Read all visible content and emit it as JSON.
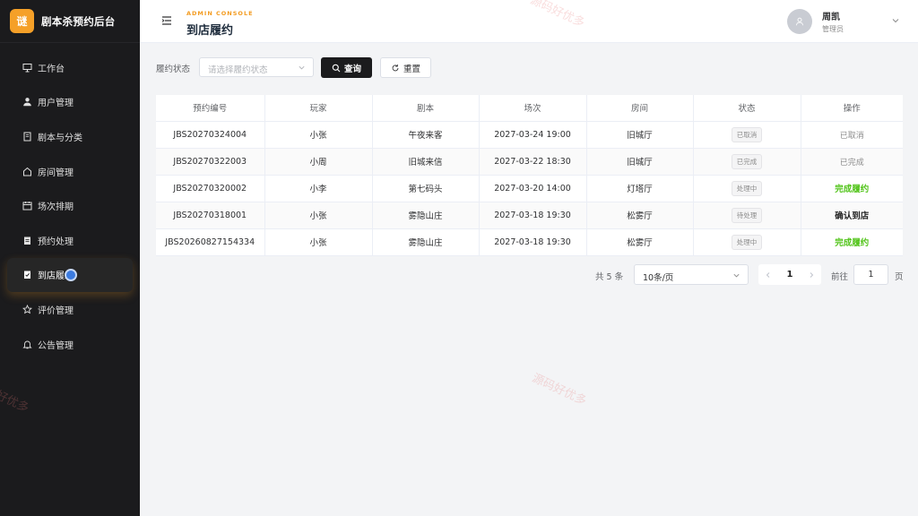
{
  "brand": {
    "logo_char": "谜",
    "title": "剧本杀预约后台"
  },
  "sidebar": {
    "items": [
      {
        "label": "工作台",
        "icon": "dashboard-icon",
        "active": false
      },
      {
        "label": "用户管理",
        "icon": "user-icon",
        "active": false
      },
      {
        "label": "剧本与分类",
        "icon": "book-icon",
        "active": false
      },
      {
        "label": "房间管理",
        "icon": "home-icon",
        "active": false
      },
      {
        "label": "场次排期",
        "icon": "calendar-icon",
        "active": false
      },
      {
        "label": "预约处理",
        "icon": "clipboard-icon",
        "active": false
      },
      {
        "label": "到店履约",
        "icon": "check-clipboard-icon",
        "active": true
      },
      {
        "label": "评价管理",
        "icon": "star-icon",
        "active": false
      },
      {
        "label": "公告管理",
        "icon": "bell-icon",
        "active": false
      }
    ]
  },
  "header": {
    "subtitle": "ADMIN CONSOLE",
    "title": "到店履约",
    "user_name": "周凯",
    "user_role": "管理员"
  },
  "filter": {
    "label": "履约状态",
    "placeholder": "请选择履约状态",
    "query_label": "查询",
    "reset_label": "重置"
  },
  "table": {
    "columns": [
      "预约编号",
      "玩家",
      "剧本",
      "场次",
      "房间",
      "状态",
      "操作"
    ],
    "rows": [
      {
        "id": "JBS20270324004",
        "player": "小张",
        "script": "午夜来客",
        "session": "2027-03-24 19:00",
        "room": "旧城厅",
        "status": "已取消",
        "action": "已取消",
        "action_style": "muted"
      },
      {
        "id": "JBS20270322003",
        "player": "小周",
        "script": "旧城来信",
        "session": "2027-03-22 18:30",
        "room": "旧城厅",
        "status": "已完成",
        "action": "已完成",
        "action_style": "muted"
      },
      {
        "id": "JBS20270320002",
        "player": "小李",
        "script": "第七码头",
        "session": "2027-03-20 14:00",
        "room": "灯塔厅",
        "status": "处理中",
        "action": "完成履约",
        "action_style": "green"
      },
      {
        "id": "JBS20270318001",
        "player": "小张",
        "script": "雾隐山庄",
        "session": "2027-03-18 19:30",
        "room": "松雾厅",
        "status": "待处理",
        "action": "确认到店",
        "action_style": "dark"
      },
      {
        "id": "JBS20260827154334",
        "player": "小张",
        "script": "雾隐山庄",
        "session": "2027-03-18 19:30",
        "room": "松雾厅",
        "status": "处理中",
        "action": "完成履约",
        "action_style": "green"
      }
    ]
  },
  "pagination": {
    "total_text": "共 5 条",
    "page_size": "10条/页",
    "current_page": "1",
    "goto_label": "前往",
    "goto_value": "1",
    "page_unit": "页"
  },
  "watermark": "源码好优多",
  "colors": {
    "accent": "#f5a028",
    "sidebar_bg": "#1b1b1d",
    "success": "#52c41a"
  }
}
